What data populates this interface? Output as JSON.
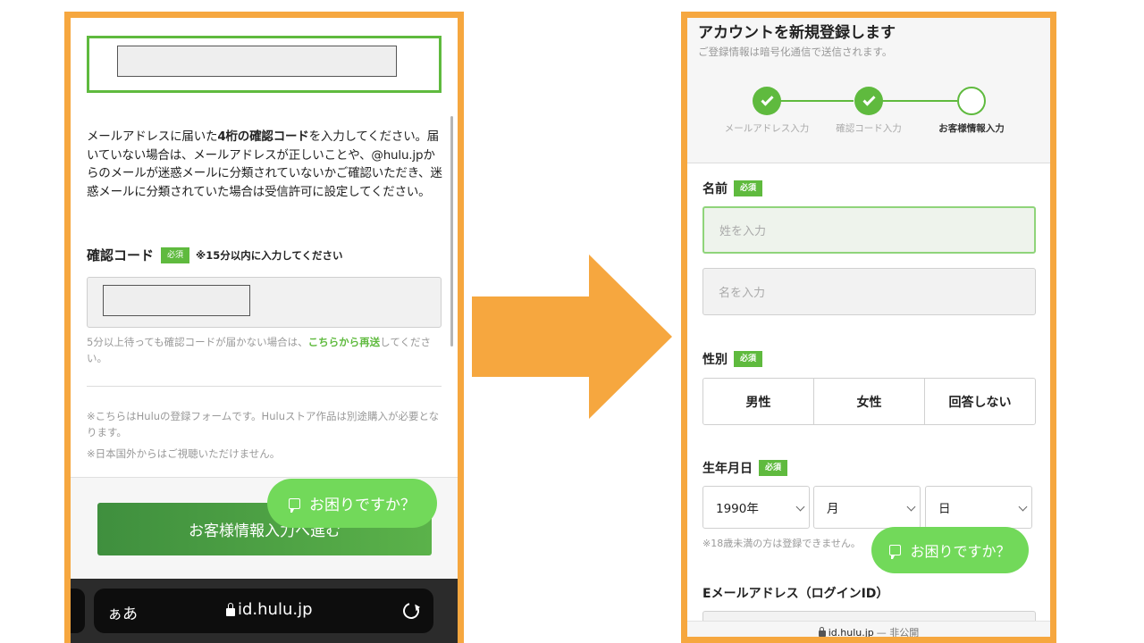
{
  "left": {
    "instruction_pre": "メールアドレスに届いた",
    "instruction_bold": "4桁の確認コード",
    "instruction_post": "を入力してください。届いていない場合は、メールアドレスが正しいことや、@hulu.jpからのメールが迷惑メールに分類されていないかご確認いただき、迷惑メールに分類されていた場合は受信許可に設定してください。",
    "code_label": "確認コード",
    "required_badge": "必須",
    "code_note": "※15分以内に入力してください",
    "resend_pre": "5分以上待っても確認コードが届かない場合は、",
    "resend_link": "こちらから再送",
    "resend_post": "してください。",
    "notes": [
      "※こちらはHuluの登録フォームです。Huluストア作品は別途購入が必要となります。",
      "※日本国外からはご視聴いただけません。"
    ],
    "proceed_button": "お客様情報入力へ進む",
    "help_button": "お困りですか？",
    "browser": {
      "aa": "ぁあ",
      "url": "id.hulu.jp"
    }
  },
  "right": {
    "title": "アカウントを新規登録します",
    "subtitle": "ご登録情報は暗号化通信で送信されます。",
    "steps": [
      {
        "label": "メールアドレス入力",
        "state": "done"
      },
      {
        "label": "確認コード入力",
        "state": "done"
      },
      {
        "label": "お客様情報入力",
        "state": "current"
      }
    ],
    "name_label": "名前",
    "required_badge": "必須",
    "last_name_placeholder": "姓を入力",
    "first_name_placeholder": "名を入力",
    "gender_label": "性別",
    "gender_options": [
      "男性",
      "女性",
      "回答しない"
    ],
    "birth_label": "生年月日",
    "birth_year": "1990年",
    "birth_month": "月",
    "birth_day": "日",
    "age_note": "※18歳未満の方は登録できません。",
    "help_button": "お困りですか？",
    "email_label": "Eメールアドレス（ログインID）",
    "footer_url": "id.hulu.jp",
    "footer_private": "— 非公開"
  },
  "colors": {
    "frame_orange": "#f6a73f",
    "accent_green": "#5fba3e",
    "help_green": "#72d95a"
  }
}
